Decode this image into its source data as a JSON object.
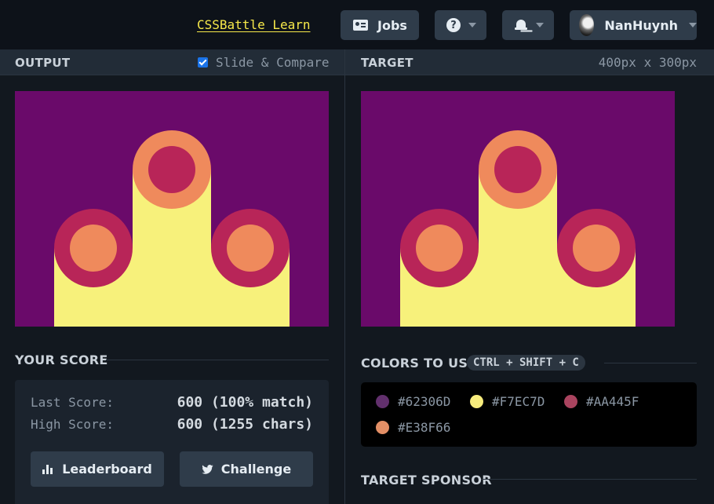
{
  "topbar": {
    "learn_link": "CSSBattle Learn",
    "jobs_label": "Jobs",
    "help_glyph": "?",
    "username": "NanHuynh",
    "icons": [
      "id-card-icon",
      "question-circle-icon",
      "bell-icon",
      "chevron-down-icon",
      "avatar"
    ]
  },
  "output_panel": {
    "title": "OUTPUT",
    "slide_compare_label": "Slide & Compare",
    "slide_compare_checked": true
  },
  "target_panel": {
    "title": "TARGET",
    "dimensions": "400px x 300px"
  },
  "score": {
    "title": "YOUR SCORE",
    "last_label": "Last Score:",
    "last_value": "600 (100% match)",
    "high_label": "High Score:",
    "high_value": "600 (1255 chars)",
    "leaderboard_label": "Leaderboard",
    "challenge_label": "Challenge"
  },
  "colors": {
    "title": "COLORS TO USE",
    "shortcut": "CTRL + SHIFT + C",
    "list": [
      {
        "hex": "#62306D"
      },
      {
        "hex": "#F7EC7D"
      },
      {
        "hex": "#AA445F"
      },
      {
        "hex": "#E38F66"
      }
    ]
  },
  "sponsor": {
    "title": "TARGET SPONSOR"
  },
  "palette": {
    "bg": "#6a0a6a",
    "yellow": "#f7f17b",
    "crimson": "#b82558",
    "orange": "#ef8a5c"
  }
}
